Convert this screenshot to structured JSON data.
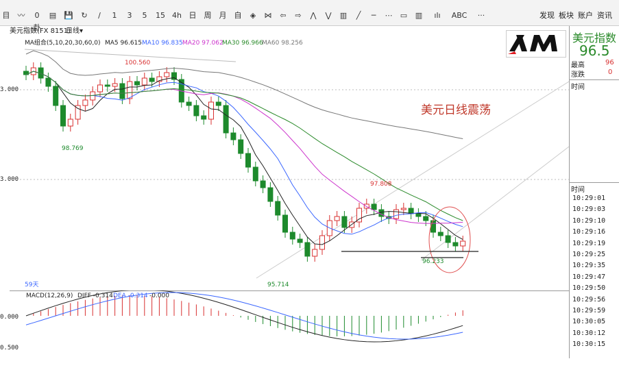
{
  "toolbar": {
    "tools": [
      "目",
      "〰",
      "0卦",
      "▤",
      "💾",
      "↻",
      "∕",
      "1",
      "3",
      "5",
      "15",
      "4h",
      "日",
      "周",
      "月",
      "自",
      "◈",
      "⋈",
      "⇦",
      "⇨",
      "⋀",
      "⋁",
      "▥",
      "╱",
      "─",
      "⋯",
      "▭",
      "▥",
      "ılı",
      "ABC",
      "···"
    ],
    "right_items": [
      "发现",
      "板块",
      "账户",
      "资讯"
    ]
  },
  "tabbar": {
    "symbol": "美元指数(FX 8151)",
    "period": "日线▾",
    "ma_label": "MA组合(5,10,20,30,60,0)",
    "ma5": "MA5 96.615",
    "ma10": "MA10 96.835",
    "ma20": "MA20 97.062",
    "ma30": "MA30 96.966",
    "ma60": "MA60 98.256"
  },
  "colors": {
    "ma5": "#222222",
    "ma10": "#3a66ff",
    "ma20": "#cc33cc",
    "ma30": "#2a8a2a",
    "ma60": "#777777",
    "up": "#d83030",
    "down": "#1d8a2c",
    "annotation": "#c0392b"
  },
  "price_labels": {
    "high_1": "100.560",
    "low_1": "98.769",
    "low_2": "95.714",
    "high_2": "97.808",
    "low_3": "96.233"
  },
  "annotation": "美元日线震荡",
  "days_label": "59天",
  "y_labels": [
    "3.000",
    "3.000",
    "0.000",
    "0.500"
  ],
  "macd": {
    "label": "MACD(12,26,9)",
    "diff": "DIFF -0.314",
    "dea": "DEA -0.314",
    "macd_val": "-0.000"
  },
  "logo": "XM",
  "right_panel": {
    "title": "美元指数",
    "price": "96.5",
    "high_label": "最高",
    "high_val": "96",
    "change_label": "涨跌",
    "change_val": "0",
    "time_label_1": "时间",
    "time_label_2": "时间",
    "times": [
      "10:29:01",
      "10:29:03",
      "10:29:10",
      "10:29:16",
      "10:29:19",
      "10:29:25",
      "10:29:35",
      "10:29:47",
      "10:29:50",
      "10:29:56",
      "10:29:59",
      "10:30:05",
      "10:30:12",
      "10:30:15"
    ]
  }
}
